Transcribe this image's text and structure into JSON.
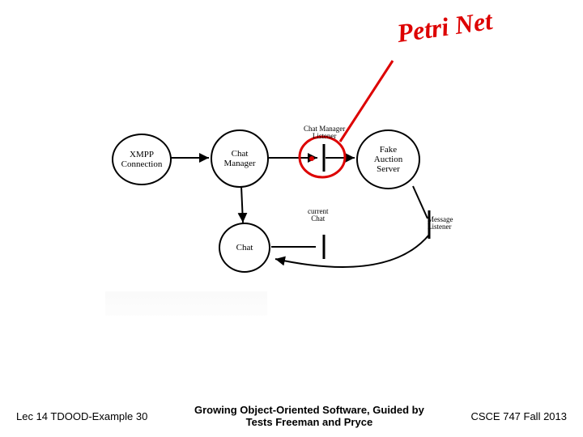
{
  "annotation": {
    "text": "Petri Net"
  },
  "diagram": {
    "nodes": {
      "xmpp": "XMPP\nConnection",
      "chatmgr": "Chat\nManager",
      "fake": "Fake\nAuction\nServer",
      "chat": "Chat"
    },
    "labels": {
      "cml": "Chat Manager\nListener",
      "curchat": "current\nChat",
      "msglistener": "Message\nListener"
    }
  },
  "footer": {
    "left": "Lec 14 TDOOD-Example 30",
    "center_line1": "Growing Object-Oriented Software, Guided by",
    "center_line2": "Tests Freeman and Pryce",
    "right": "CSCE 747 Fall 2013"
  }
}
